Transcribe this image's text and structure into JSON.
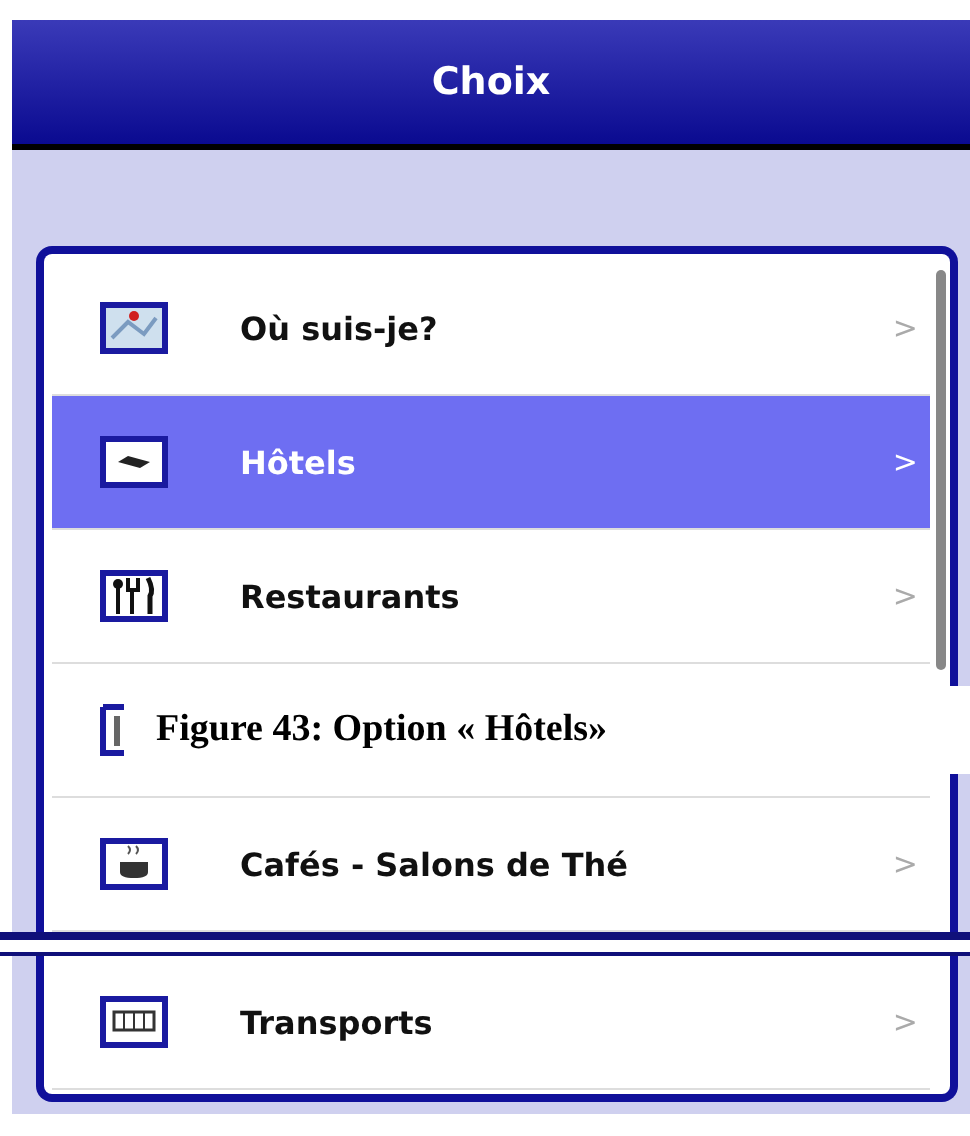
{
  "header": {
    "title": "Choix"
  },
  "menu": {
    "items": [
      {
        "label": "Où suis-je?",
        "chevron": ">",
        "selected": false
      },
      {
        "label": "Hôtels",
        "chevron": ">",
        "selected": true
      },
      {
        "label": "Restaurants",
        "chevron": ">",
        "selected": false
      },
      {
        "selected": false
      },
      {
        "label": "Cafés - Salons de Thé",
        "chevron": ">",
        "selected": false
      },
      {
        "label": "Transports",
        "chevron": ">",
        "selected": false
      }
    ]
  },
  "caption": "Figure 43: Option « Hôtels»"
}
